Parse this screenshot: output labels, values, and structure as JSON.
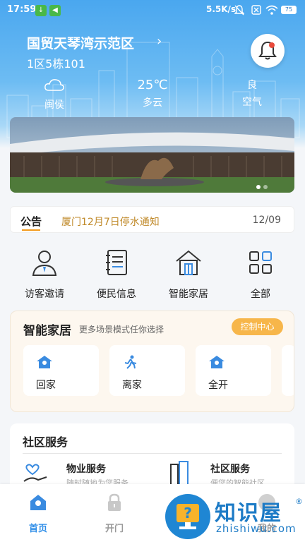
{
  "status_bar": {
    "time": "17:59",
    "net_speed": "5.5K/s",
    "battery": "75"
  },
  "header": {
    "location": "国贸天琴湾示范区",
    "unit": "1区5栋101"
  },
  "weather": {
    "left": {
      "icon": "cloud-icon",
      "label": "闽侯"
    },
    "center": {
      "temp": "25℃",
      "label": "多云"
    },
    "right": {
      "value": "良",
      "label": "空气"
    }
  },
  "notice": {
    "tag": "公告",
    "text": "厦门12月7日停水通知",
    "date": "12/09"
  },
  "quick_menu": [
    {
      "label": "访客邀请",
      "icon": "visitor-icon"
    },
    {
      "label": "便民信息",
      "icon": "notebook-icon"
    },
    {
      "label": "智能家居",
      "icon": "house-icon"
    },
    {
      "label": "全部",
      "icon": "grid-icon"
    }
  ],
  "smart_home": {
    "title": "智能家居",
    "subtitle": "更多场景模式任你选择",
    "control_label": "控制中心",
    "scenes": [
      {
        "label": "回家",
        "icon": "home-icon"
      },
      {
        "label": "离家",
        "icon": "running-person-icon"
      },
      {
        "label": "全开",
        "icon": "home-icon"
      }
    ]
  },
  "community": {
    "title": "社区服务",
    "items": [
      {
        "name": "物业服务",
        "desc": "随时随地为您服务",
        "icon": "heart-hand-icon"
      },
      {
        "name": "社区服务",
        "desc": "便您的智能社区",
        "icon": "building-icon"
      }
    ]
  },
  "tabbar": [
    {
      "label": "首页",
      "icon": "home-tab-icon",
      "active": true
    },
    {
      "label": "开门",
      "icon": "lock-icon",
      "active": false
    },
    {
      "label": "我的",
      "icon": "profile-icon",
      "active": false
    }
  ],
  "watermark": {
    "cn": "知识屋",
    "en": "zhishiwu.com",
    "reg": "®"
  },
  "colors": {
    "primary": "#2f8ee8",
    "accent": "#f7b64a",
    "notice_text": "#c08a2a"
  }
}
